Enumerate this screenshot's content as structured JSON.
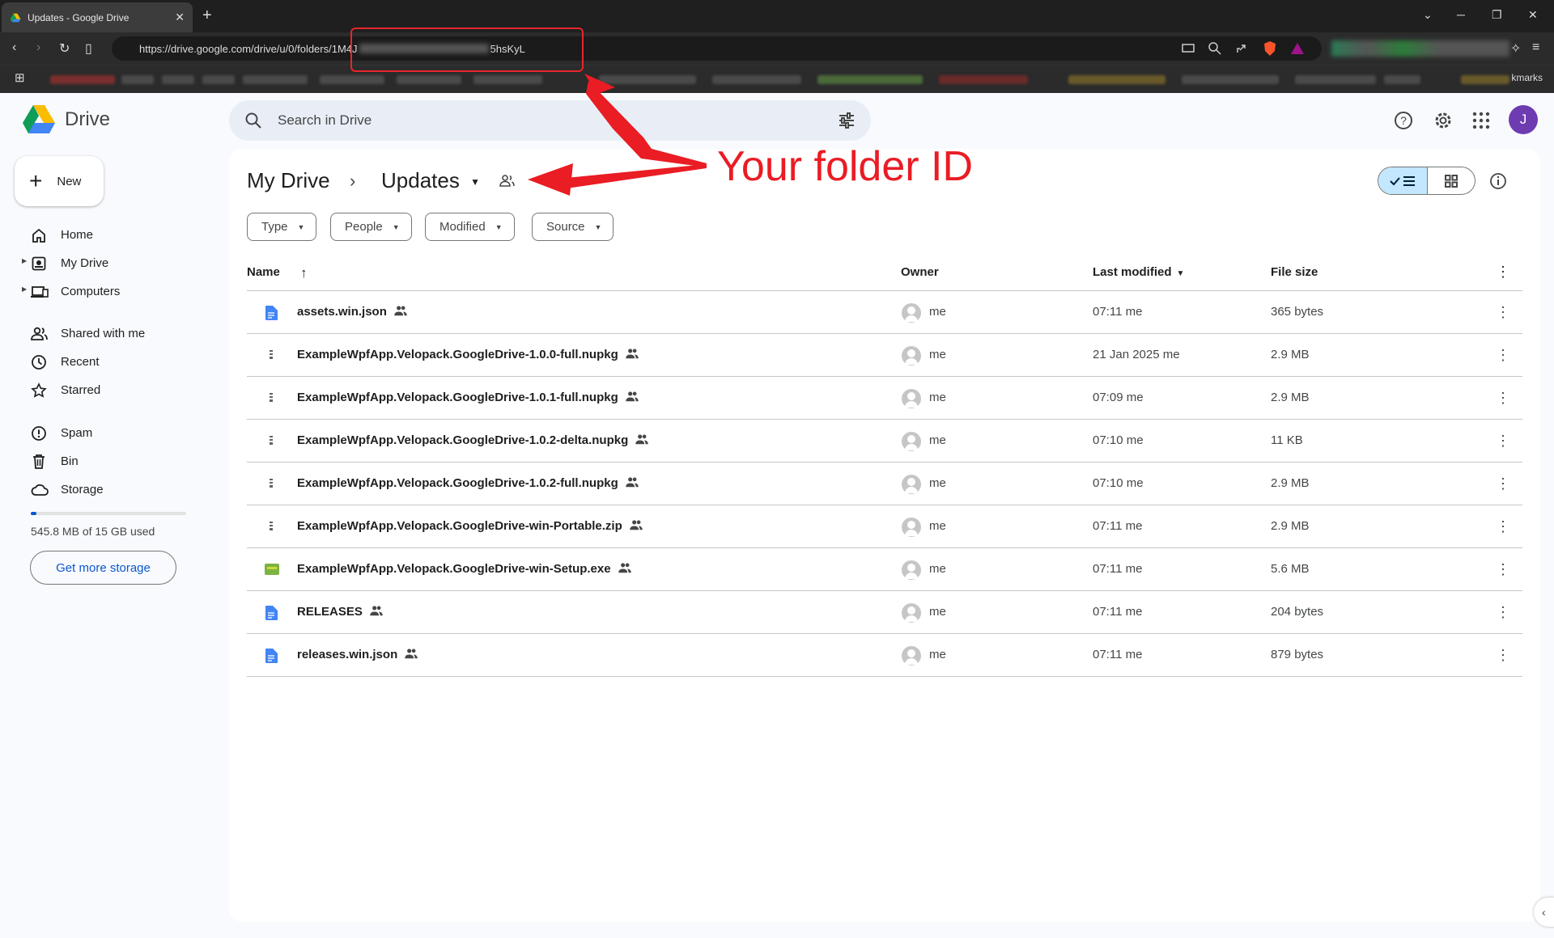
{
  "browser": {
    "tab_title": "Updates - Google Drive",
    "url_prefix": "https://drive.google.com/drive/u/0/folders/1M4J",
    "url_suffix": "5hsKyL",
    "bookmarks_label": "kmarks"
  },
  "annotation": {
    "label": "Your folder ID",
    "color": "#ea1c24"
  },
  "app": {
    "name": "Drive",
    "search_placeholder": "Search in Drive",
    "avatar_initial": "J"
  },
  "sidebar": {
    "new_label": "New",
    "items": [
      {
        "label": "Home",
        "icon": "home-icon"
      },
      {
        "label": "My Drive",
        "icon": "my-drive-icon"
      },
      {
        "label": "Computers",
        "icon": "computers-icon"
      },
      {
        "label": "Shared with me",
        "icon": "shared-icon"
      },
      {
        "label": "Recent",
        "icon": "clock-icon"
      },
      {
        "label": "Starred",
        "icon": "star-icon"
      },
      {
        "label": "Spam",
        "icon": "spam-icon"
      },
      {
        "label": "Bin",
        "icon": "bin-icon"
      },
      {
        "label": "Storage",
        "icon": "cloud-icon"
      }
    ],
    "storage_used_fraction": 0.036,
    "storage_text": "545.8 MB of 15 GB used",
    "more_storage_label": "Get more storage"
  },
  "breadcrumb": {
    "root": "My Drive",
    "current": "Updates"
  },
  "filters": [
    "Type",
    "People",
    "Modified",
    "Source"
  ],
  "table": {
    "headers": {
      "name": "Name",
      "owner": "Owner",
      "modified": "Last modified",
      "size": "File size"
    },
    "rows": [
      {
        "name": "assets.win.json",
        "type": "doc",
        "owner": "me",
        "modified": "07:11 me",
        "size": "365 bytes"
      },
      {
        "name": "ExampleWpfApp.Velopack.GoogleDrive-1.0.0-full.nupkg",
        "type": "archive",
        "owner": "me",
        "modified": "21 Jan 2025 me",
        "size": "2.9 MB"
      },
      {
        "name": "ExampleWpfApp.Velopack.GoogleDrive-1.0.1-full.nupkg",
        "type": "archive",
        "owner": "me",
        "modified": "07:09 me",
        "size": "2.9 MB"
      },
      {
        "name": "ExampleWpfApp.Velopack.GoogleDrive-1.0.2-delta.nupkg",
        "type": "archive",
        "owner": "me",
        "modified": "07:10 me",
        "size": "11 KB"
      },
      {
        "name": "ExampleWpfApp.Velopack.GoogleDrive-1.0.2-full.nupkg",
        "type": "archive",
        "owner": "me",
        "modified": "07:10 me",
        "size": "2.9 MB"
      },
      {
        "name": "ExampleWpfApp.Velopack.GoogleDrive-win-Portable.zip",
        "type": "archive",
        "owner": "me",
        "modified": "07:11 me",
        "size": "2.9 MB"
      },
      {
        "name": "ExampleWpfApp.Velopack.GoogleDrive-win-Setup.exe",
        "type": "exe",
        "owner": "me",
        "modified": "07:11 me",
        "size": "5.6 MB"
      },
      {
        "name": "RELEASES",
        "type": "doc",
        "owner": "me",
        "modified": "07:11 me",
        "size": "204 bytes"
      },
      {
        "name": "releases.win.json",
        "type": "doc",
        "owner": "me",
        "modified": "07:11 me",
        "size": "879 bytes"
      }
    ]
  }
}
